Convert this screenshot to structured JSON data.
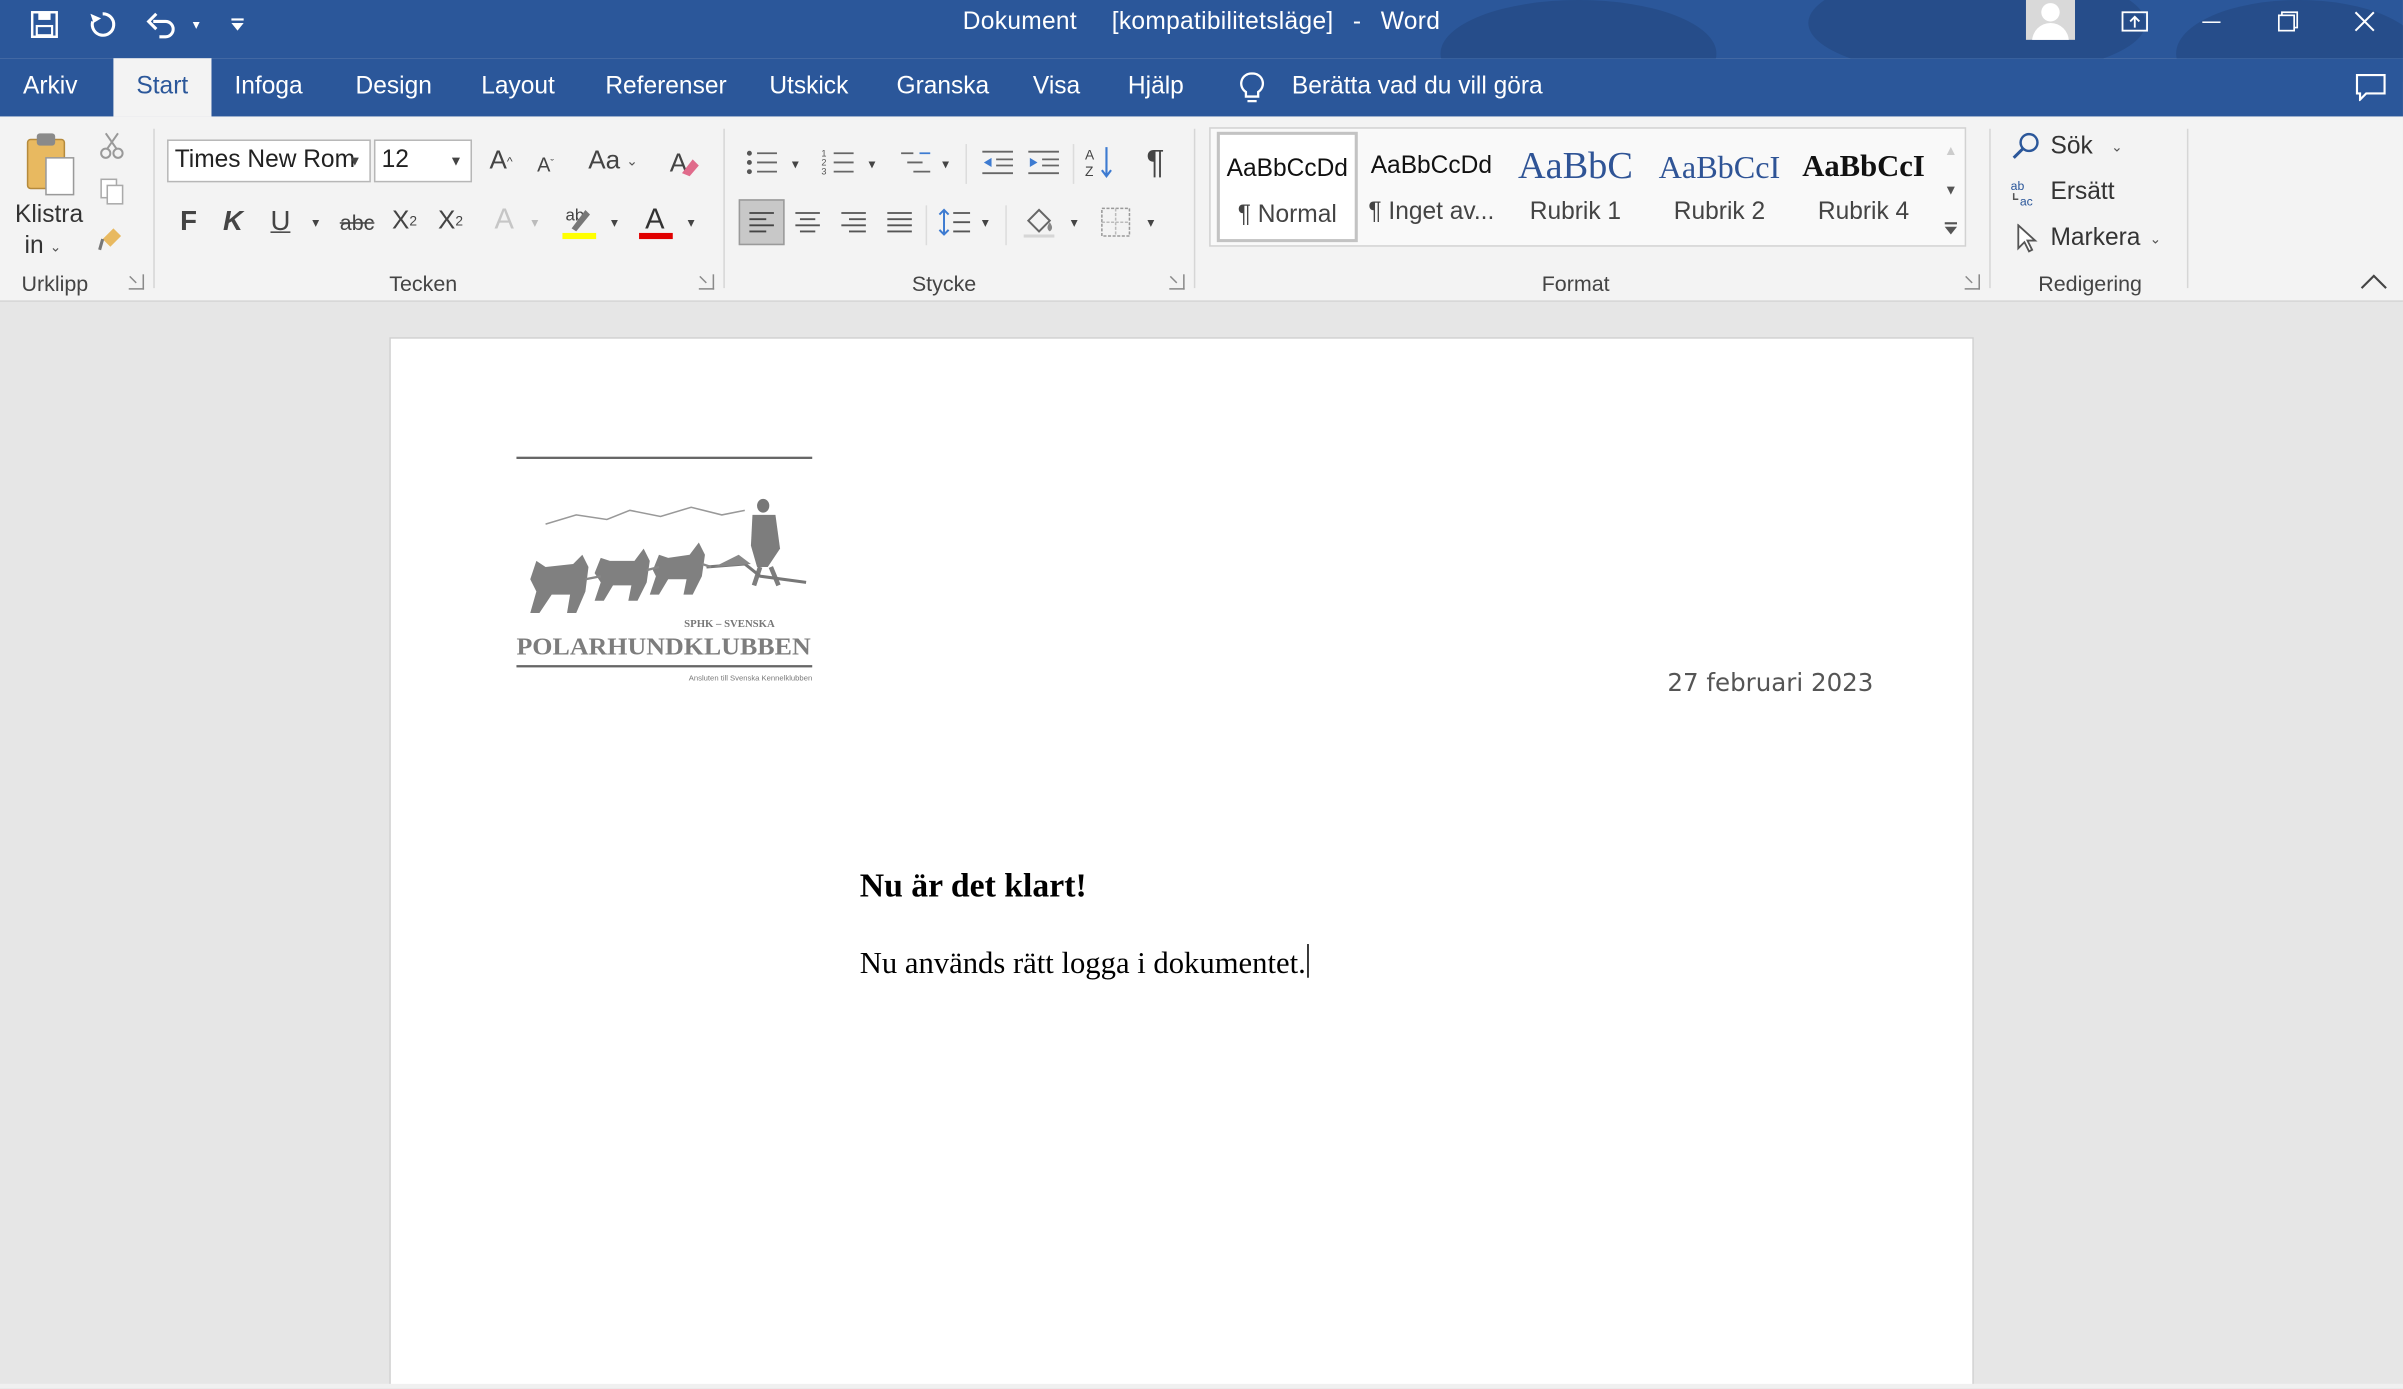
{
  "window": {
    "title": "Dokument",
    "mode": "[kompatibilitetsläge]",
    "separator": "-",
    "app": "Word",
    "accent_color": "#2b579a"
  },
  "quick_access": {
    "icons": [
      "save-icon",
      "autosave-refresh-icon",
      "undo-icon",
      "customize-qat-icon"
    ]
  },
  "tabs": [
    {
      "label": "Arkiv"
    },
    {
      "label": "Start"
    },
    {
      "label": "Infoga"
    },
    {
      "label": "Design"
    },
    {
      "label": "Layout"
    },
    {
      "label": "Referenser"
    },
    {
      "label": "Utskick"
    },
    {
      "label": "Granska"
    },
    {
      "label": "Visa"
    },
    {
      "label": "Hjälp"
    }
  ],
  "tell_me": {
    "label": "Berätta vad du vill göra"
  },
  "ribbon": {
    "clipboard": {
      "paste_label_line1": "Klistra",
      "paste_label_line2": "in",
      "group": "Urklipp"
    },
    "font": {
      "family": "Times New Rom",
      "size": "12",
      "case_label": "Aa",
      "bold": "F",
      "italic": "K",
      "underline": "U",
      "strike": "abc",
      "group": "Tecken",
      "highlight_color": "#ffff00",
      "font_color": "#e00000"
    },
    "paragraph": {
      "group": "Stycke"
    },
    "styles": {
      "group": "Format",
      "items": [
        {
          "preview": "AaBbCcDd",
          "name": "¶ Normal"
        },
        {
          "preview": "AaBbCcDd",
          "name": "¶ Inget av..."
        },
        {
          "preview": "AaBbC",
          "name": "Rubrik 1"
        },
        {
          "preview": "AaBbCcI",
          "name": "Rubrik 2"
        },
        {
          "preview": "AaBbCcI",
          "name": "Rubrik 4"
        }
      ]
    },
    "editing": {
      "find": "Sök",
      "replace": "Ersätt",
      "select": "Markera",
      "group": "Redigering"
    }
  },
  "document": {
    "logo": {
      "line1": "SPHK – SVENSKA",
      "line2": "POLARHUNDKLUBBEN",
      "line3": "Ansluten till Svenska Kennelklubben"
    },
    "date": "27 februari 2023",
    "heading": "Nu är det klart!",
    "body": "Nu används rätt logga i dokumentet."
  }
}
